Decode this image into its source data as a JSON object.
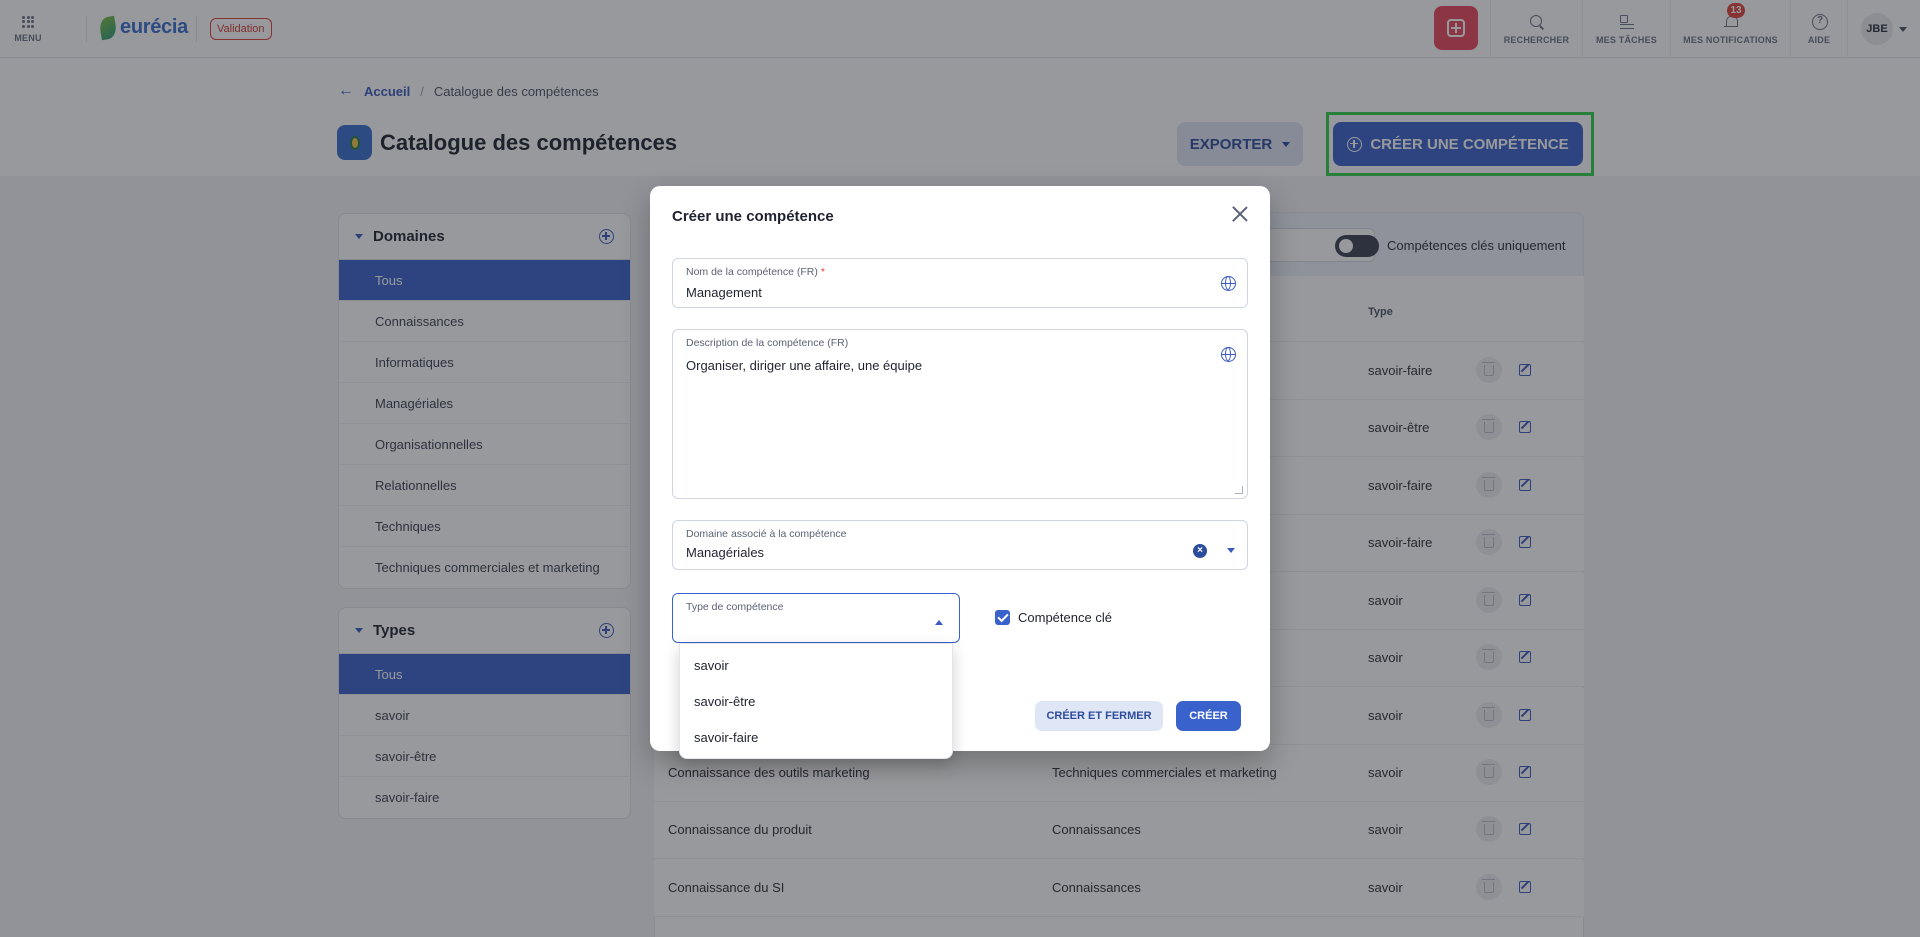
{
  "topbar": {
    "menu_label": "MENU",
    "brand": "eurécia",
    "env_badge": "Validation",
    "search_label": "RECHERCHER",
    "tasks_label": "MES TÂCHES",
    "notifications_label": "MES NOTIFICATIONS",
    "notifications_count": "13",
    "help_label": "AIDE",
    "user_initials": "JBE"
  },
  "breadcrumb": {
    "home": "Accueil",
    "separator": "/",
    "current": "Catalogue des compétences"
  },
  "page": {
    "title": "Catalogue des compétences",
    "export_label": "EXPORTER",
    "create_label": "CRÉER UNE COMPÉTENCE"
  },
  "domains_panel": {
    "title": "Domaines",
    "items": [
      "Tous",
      "Connaissances",
      "Informatiques",
      "Managériales",
      "Organisationnelles",
      "Relationnelles",
      "Techniques",
      "Techniques commerciales et marketing"
    ]
  },
  "types_panel": {
    "title": "Types",
    "items": [
      "Tous",
      "savoir",
      "savoir-être",
      "savoir-faire"
    ]
  },
  "table": {
    "toggle_label": "Compétences clés uniquement",
    "type_header": "Type",
    "rows": [
      {
        "name": "",
        "domain": "",
        "type": "savoir-faire"
      },
      {
        "name": "",
        "domain": "",
        "type": "savoir-être"
      },
      {
        "name": "",
        "domain": "",
        "type": "savoir-faire"
      },
      {
        "name": "",
        "domain": "",
        "type": "savoir-faire"
      },
      {
        "name": "",
        "domain": "",
        "type": "savoir"
      },
      {
        "name": "",
        "domain": "",
        "type": "savoir"
      },
      {
        "name": "",
        "domain": "",
        "type": "savoir"
      },
      {
        "name": "Connaissance des outils marketing",
        "domain": "Techniques commerciales et marketing",
        "type": "savoir"
      },
      {
        "name": "Connaissance du produit",
        "domain": "Connaissances",
        "type": "savoir"
      },
      {
        "name": "Connaissance du SI",
        "domain": "Connaissances",
        "type": "savoir"
      }
    ]
  },
  "modal": {
    "title": "Créer une compétence",
    "name_label": "Nom de la compétence (FR)",
    "name_required": "*",
    "name_value": "Management",
    "description_label": "Description de la compétence (FR)",
    "description_value": "Organiser, diriger une affaire, une équipe",
    "domain_label": "Domaine associé à la compétence",
    "domain_value": "Managériales",
    "type_label": "Type de compétence",
    "type_value": "",
    "key_checkbox_label": "Compétence clé",
    "key_checked": true,
    "btn_create_close": "CRÉER ET FERMER",
    "btn_create": "CRÉER"
  },
  "type_dropdown": {
    "options": [
      "savoir",
      "savoir-être",
      "savoir-faire"
    ]
  },
  "icons": {
    "menu": "grid-icon",
    "search": "search-icon",
    "tasks": "tasks-icon",
    "notifications": "bell-icon",
    "help": "help-icon",
    "globe": "globe-icon"
  },
  "colors": {
    "primary": "#3a62cc",
    "accent_pink": "#e8475f",
    "highlight": "#2ed14a",
    "badge_red": "#e0433f"
  }
}
